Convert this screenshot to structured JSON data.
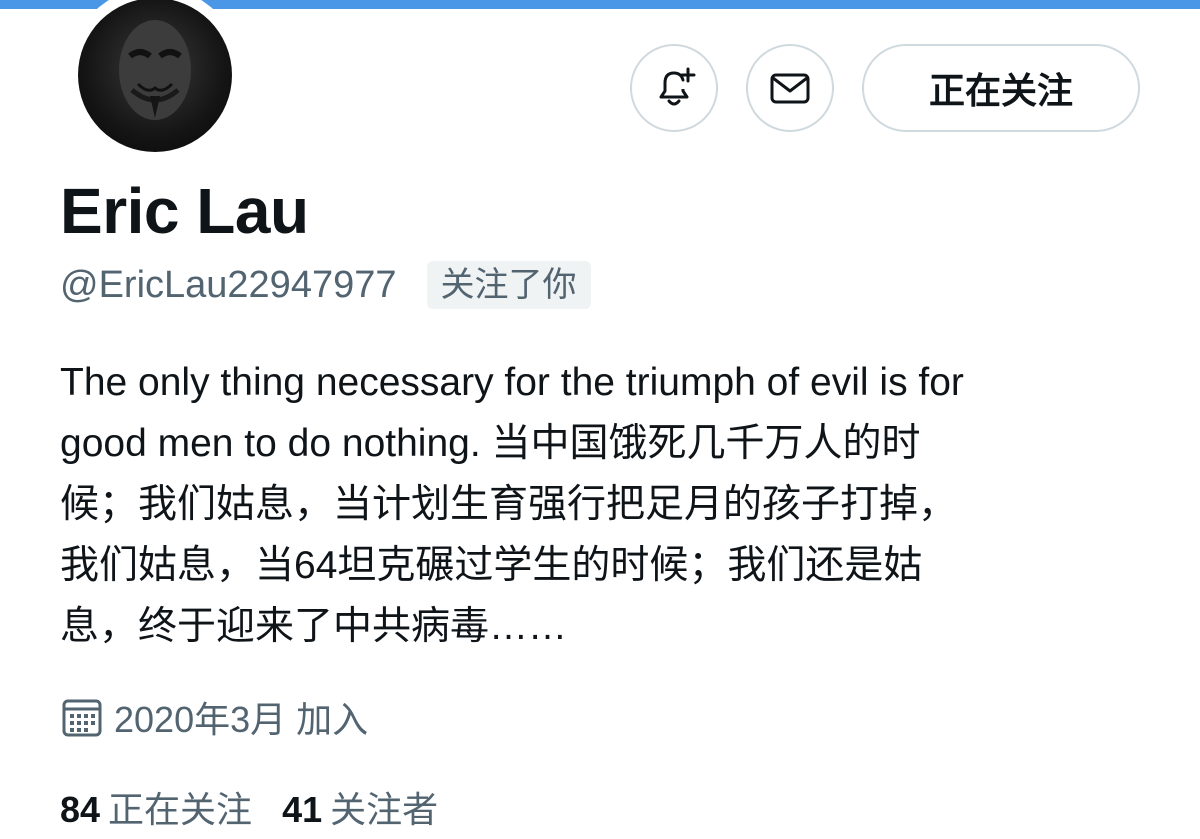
{
  "profile": {
    "display_name": "Eric Lau",
    "handle": "@EricLau22947977",
    "follows_you_badge": "关注了你",
    "avatar": "anonymous-mask-avatar"
  },
  "actions": {
    "notify_icon": "bell-plus-icon",
    "message_icon": "envelope-icon",
    "follow_label": "正在关注"
  },
  "bio": {
    "lines": [
      "The only thing necessary for the triumph of evil is for",
      "good men to do nothing. 当中国饿死几千万人的时",
      "候；我们姑息，当计划生育强行把足月的孩子打掉，",
      "我们姑息，当64坦克碾过学生的时候；我们还是姑",
      "息，终于迎来了中共病毒……"
    ]
  },
  "joined": {
    "icon": "calendar-icon",
    "text": "2020年3月 加入"
  },
  "stats": {
    "following_count": "84",
    "following_label": "正在关注",
    "followers_count": "41",
    "followers_label": "关注者"
  },
  "colors": {
    "accent_strip": "#4a97e8",
    "text_primary": "#0f1419",
    "text_secondary": "#536471",
    "border": "#cfd9de",
    "badge_bg": "#eff3f4"
  }
}
